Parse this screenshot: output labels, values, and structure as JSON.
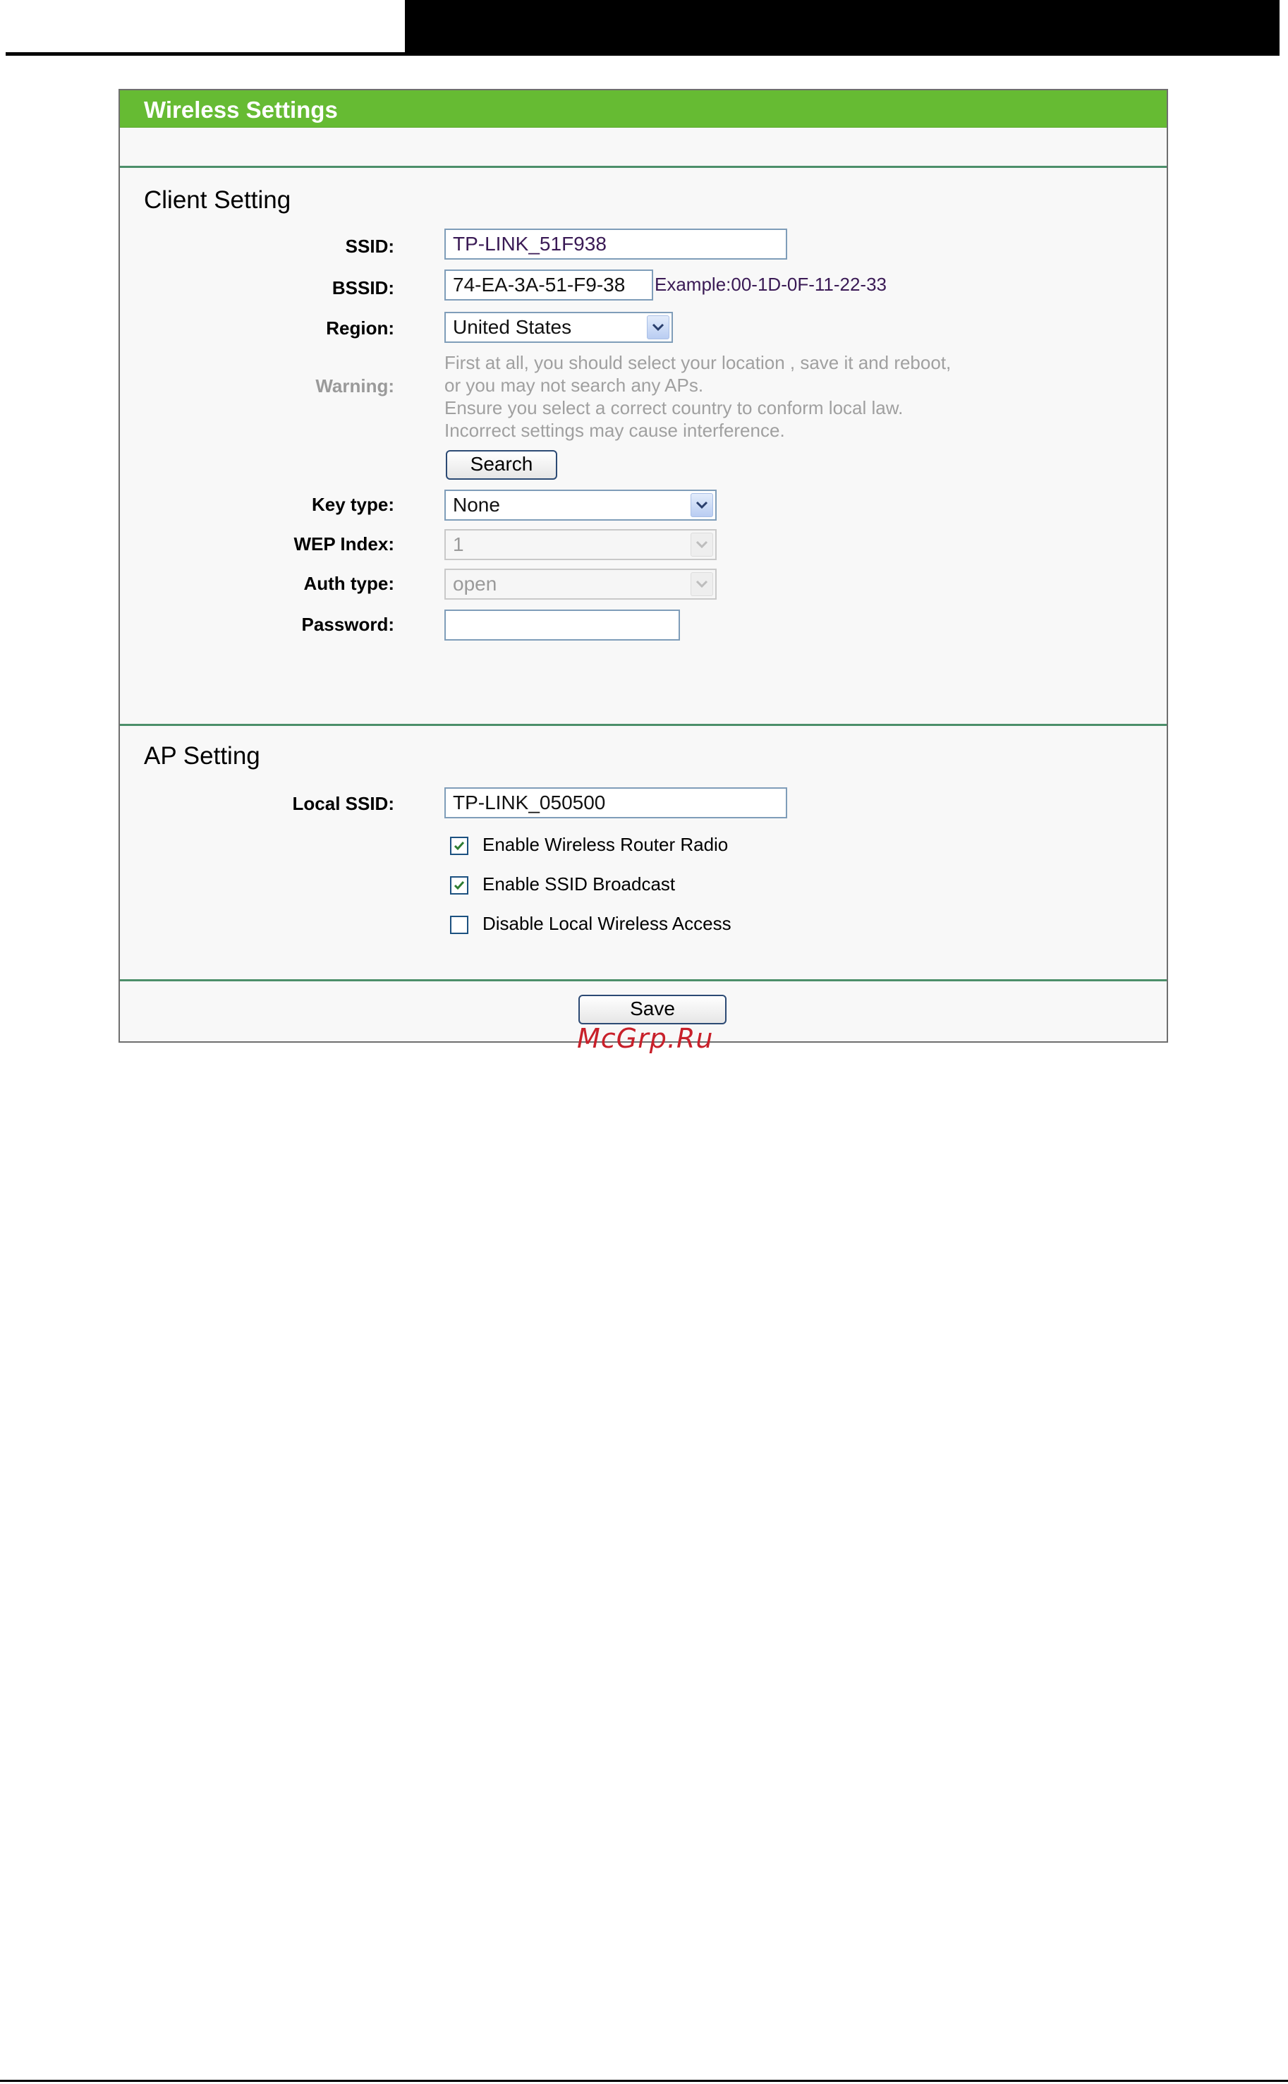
{
  "panel": {
    "title": "Wireless Settings"
  },
  "client": {
    "section_title": "Client Setting",
    "ssid": {
      "label": "SSID:",
      "value": "TP-LINK_51F938"
    },
    "bssid": {
      "label": "BSSID:",
      "value": "74-EA-3A-51-F9-38",
      "example": "Example:00-1D-0F-11-22-33"
    },
    "region": {
      "label": "Region:",
      "value": "United States"
    },
    "warning": {
      "label": "Warning:",
      "lines": [
        "First at all, you should select your location , save it and reboot,",
        "or you may not search any APs.",
        "Ensure you select a correct country to conform local law.",
        "Incorrect settings may cause interference."
      ]
    },
    "search_button": "Search",
    "key_type": {
      "label": "Key type:",
      "value": "None"
    },
    "wep_index": {
      "label": "WEP Index:",
      "value": "1"
    },
    "auth_type": {
      "label": "Auth type:",
      "value": "open"
    },
    "password": {
      "label": "Password:",
      "value": ""
    }
  },
  "ap": {
    "section_title": "AP Setting",
    "local_ssid": {
      "label": "Local SSID:",
      "value": "TP-LINK_050500"
    },
    "checkboxes": [
      {
        "label": "Enable Wireless Router Radio",
        "checked": true
      },
      {
        "label": "Enable SSID Broadcast",
        "checked": true
      },
      {
        "label": "Disable Local Wireless Access",
        "checked": false
      }
    ]
  },
  "save_button": "Save",
  "watermark": "McGrp.Ru",
  "colors": {
    "title_bar": "#66bb33",
    "separator": "#4c8f6a",
    "input_border": "#7f9db9"
  }
}
